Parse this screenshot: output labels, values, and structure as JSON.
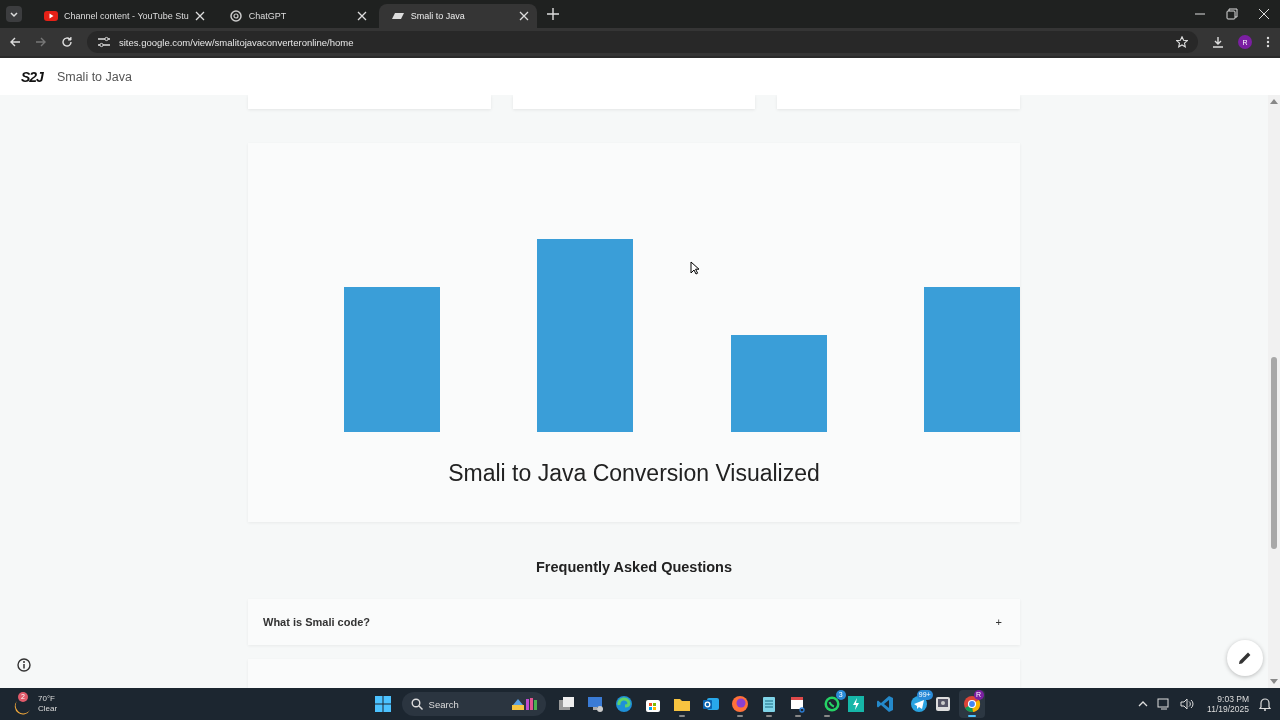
{
  "browser": {
    "tabs": [
      {
        "title": "Channel content - YouTube Stu",
        "selected": false
      },
      {
        "title": "ChatGPT",
        "selected": false
      },
      {
        "title": "Smali to Java",
        "selected": true
      }
    ],
    "url": "sites.google.com/view/smalitojavaconverteronline/home",
    "profile": "R"
  },
  "site": {
    "logo": "S2J",
    "title": "Smali to Java"
  },
  "chart_card": {
    "caption": "Smali to Java Conversion Visualized"
  },
  "faq": {
    "heading": "Frequently Asked Questions",
    "items": [
      {
        "question": "What is Smali code?",
        "toggle": "+"
      }
    ]
  },
  "taskbar": {
    "weather": {
      "badge": "2",
      "temperature": "70°F",
      "condition": "Clear"
    },
    "search": {
      "placeholder": "Search"
    },
    "apps": [
      {
        "running": false,
        "selected": false
      },
      {
        "running": false,
        "selected": false
      },
      {
        "running": false,
        "selected": false
      },
      {
        "running": false,
        "selected": false
      },
      {
        "running": true,
        "selected": false
      },
      {
        "running": false,
        "selected": false
      },
      {
        "running": true,
        "selected": false
      },
      {
        "running": true,
        "selected": false
      },
      {
        "running": true,
        "selected": false
      },
      {
        "running": true,
        "selected": false,
        "badge": "3"
      },
      {
        "running": false,
        "selected": false
      },
      {
        "running": false,
        "selected": false
      },
      {
        "running": false,
        "selected": false,
        "badge": "99+"
      },
      {
        "running": false,
        "selected": false
      },
      {
        "running": true,
        "selected": true,
        "badge": "R"
      }
    ],
    "time": "9:03 PM",
    "date": "11/19/2025"
  }
}
